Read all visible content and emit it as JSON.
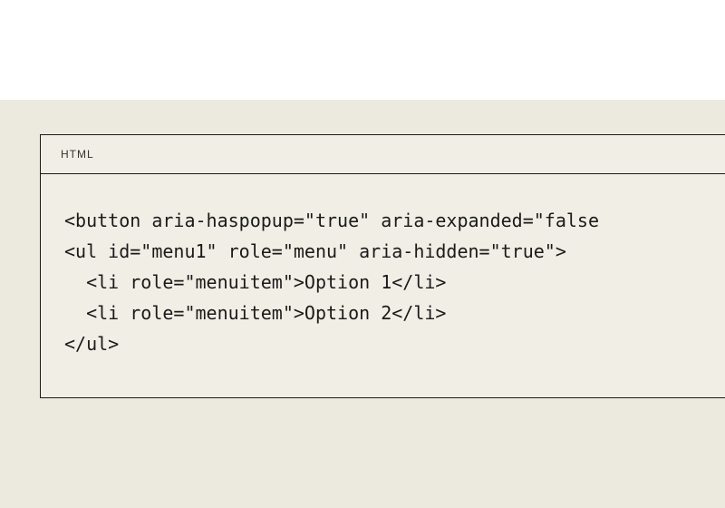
{
  "card": {
    "language_label": "HTML",
    "code": "<button aria-haspopup=\"true\" aria-expanded=\"false\n<ul id=\"menu1\" role=\"menu\" aria-hidden=\"true\">\n  <li role=\"menuitem\">Option 1</li>\n  <li role=\"menuitem\">Option 2</li>\n</ul>"
  }
}
